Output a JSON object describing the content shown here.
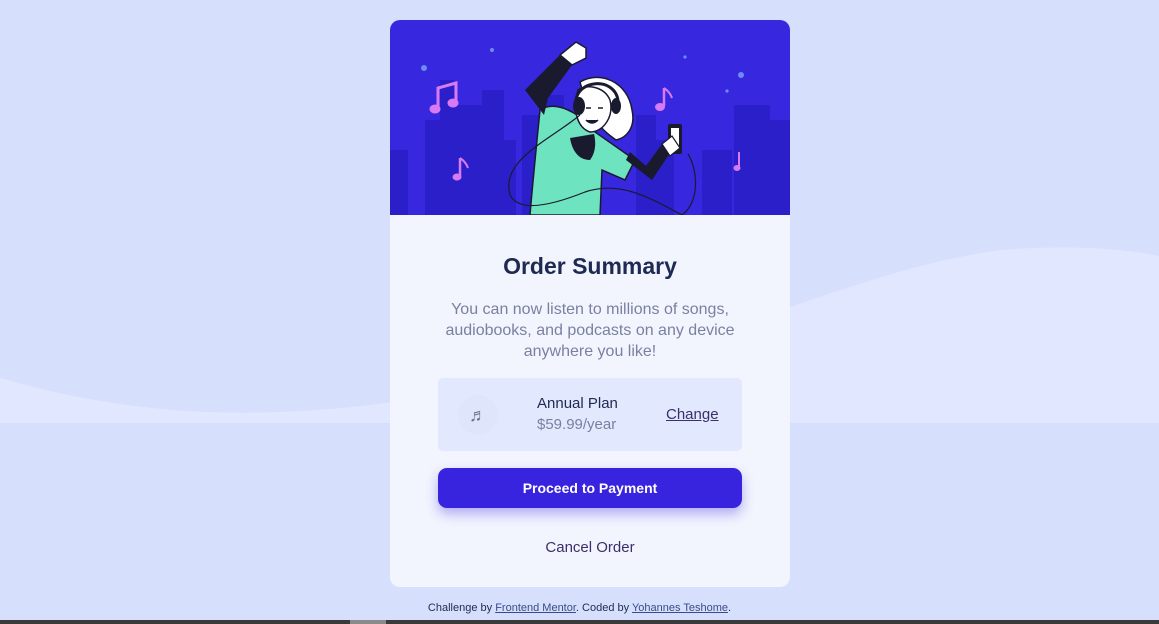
{
  "colors": {
    "background": "#d6e0fd",
    "card": "#f2f5fe",
    "hero": "#3727de",
    "accent": "#3823de",
    "title": "#1e2a52",
    "muted": "#7a80a0",
    "link": "#3a2f6a"
  },
  "card": {
    "title": "Order Summary",
    "description": "You can now listen to millions of songs, audiobooks, and podcasts on any device anywhere you like!",
    "hero_image": "illustration-hero"
  },
  "plan": {
    "icon": "music-note-icon",
    "name": "Annual Plan",
    "price": "$59.99/year",
    "change_label": "Change"
  },
  "actions": {
    "proceed_label": "Proceed to Payment",
    "cancel_label": "Cancel Order"
  },
  "attribution": {
    "prefix": "Challenge by ",
    "challenge_link": "Frontend Mentor",
    "middle": ". Coded by ",
    "author_link": "Yohannes Teshome",
    "suffix": "."
  }
}
